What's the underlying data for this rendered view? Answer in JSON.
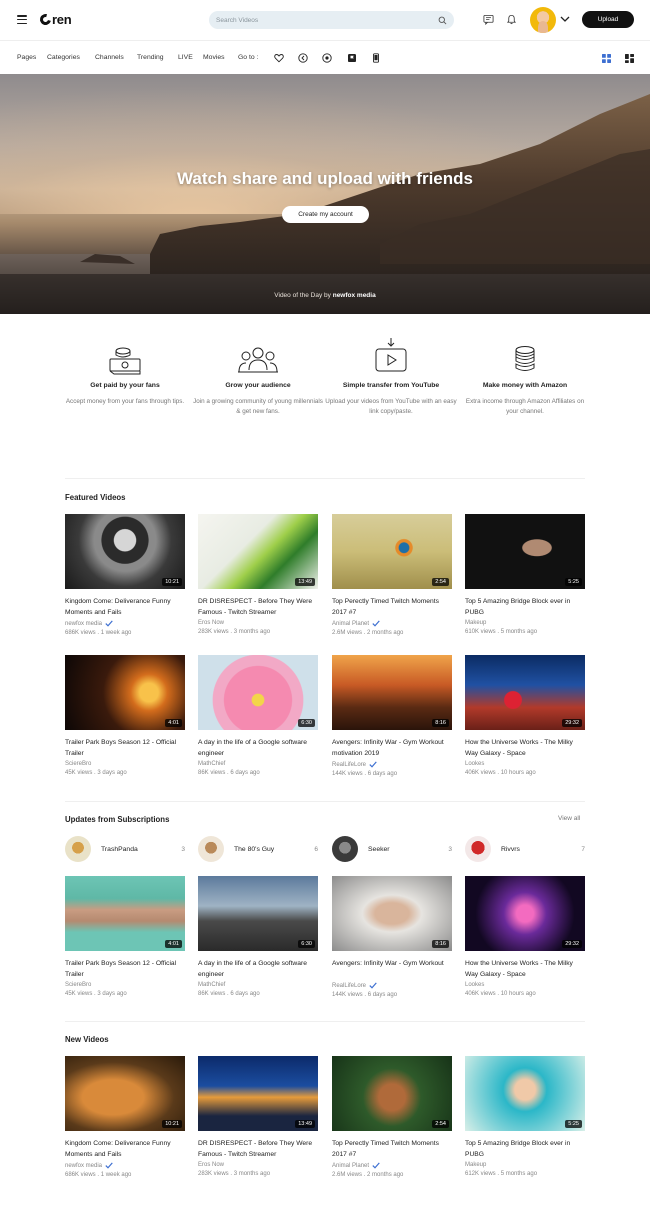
{
  "header": {
    "logo": "Oren",
    "search_placeholder": "Search Videos",
    "upload_label": "Upload"
  },
  "nav": {
    "items": [
      "Pages",
      "Categories",
      "Channels",
      "Trending",
      "LIVE",
      "Movies"
    ],
    "goto_label": "Go to :"
  },
  "hero": {
    "title": "Watch share and upload with friends",
    "cta": "Create my account",
    "credit_prefix": "Video of the Day by",
    "credit_channel": "newfox media"
  },
  "features": [
    {
      "icon": "money-icon",
      "title": "Get paid by your fans",
      "desc": "Accept money from your fans through tips."
    },
    {
      "icon": "audience-icon",
      "title": "Grow your audience",
      "desc": "Join a growing community of young millennials & get new fans."
    },
    {
      "icon": "video-transfer-icon",
      "title": "Simple transfer from YouTube",
      "desc": "Upload your videos from YouTube with an easy link copy/paste."
    },
    {
      "icon": "coins-icon",
      "title": "Make money with Amazon",
      "desc": "Extra income through Amazon Affiliates on your channel."
    }
  ],
  "featured": {
    "title": "Featured Videos",
    "videos": [
      {
        "title": "Kingdom Come: Deliverance Funny Moments and Fails",
        "channel": "newfox media",
        "verified": true,
        "views": "686K views",
        "ago": "1 week ago",
        "duration": "10:21"
      },
      {
        "title": "DR DISRESPECT - Before They Were Famous - Twitch Streamer",
        "channel": "Eros Now",
        "verified": false,
        "views": "283K views",
        "ago": "3 months ago",
        "duration": "13:49"
      },
      {
        "title": "Top Perectly Timed Twitch Moments 2017 #7",
        "channel": "Animal Planet",
        "verified": true,
        "views": "2.6M views",
        "ago": "2 months ago",
        "duration": "2:54"
      },
      {
        "title": "Top 5 Amazing Bridge Block ever in PUBG",
        "channel": "Makeup",
        "verified": false,
        "views": "610K views",
        "ago": "5 months ago",
        "duration": "5:25"
      },
      {
        "title": "Trailer Park Boys Season 12 - Official Trailer",
        "channel": "SciereBro",
        "verified": false,
        "views": "45K views",
        "ago": "3 days ago",
        "duration": "4:01"
      },
      {
        "title": "A day in the life of a Google software engineer",
        "channel": "MathChief",
        "verified": false,
        "views": "86K views",
        "ago": "6 days ago",
        "duration": "6:30"
      },
      {
        "title": "Avengers: Infinity War - Gym Workout motivation 2019",
        "channel": "RealLifeLore",
        "verified": true,
        "views": "144K views",
        "ago": "6 days ago",
        "duration": "8:16"
      },
      {
        "title": "How the Universe Works - The Milky Way Galaxy - Space",
        "channel": "Lookes",
        "verified": false,
        "views": "406K views",
        "ago": "10 hours ago",
        "duration": "29:32"
      }
    ]
  },
  "subscriptions": {
    "title": "Updates from Subscriptions",
    "view_all": "View all",
    "channels": [
      {
        "name": "TrashPanda",
        "count": "3"
      },
      {
        "name": "The 80's Guy",
        "count": "6"
      },
      {
        "name": "Seeker",
        "count": "3"
      },
      {
        "name": "Rivvrs",
        "count": "7"
      }
    ],
    "videos": [
      {
        "title": "Trailer Park Boys Season 12 - Official Trailer",
        "channel": "SciereBro",
        "verified": false,
        "views": "45K views",
        "ago": "3 days ago",
        "duration": "4:01"
      },
      {
        "title": "A day in the life of a Google software engineer",
        "channel": "MathChief",
        "verified": false,
        "views": "86K views",
        "ago": "6 days ago",
        "duration": "6:30"
      },
      {
        "title": "Avengers: Infinity War - Gym Workout",
        "channel": "RealLifeLore",
        "verified": true,
        "views": "144K views",
        "ago": "6 days ago",
        "duration": "8:16"
      },
      {
        "title": "How the Universe Works - The Milky Way Galaxy - Space",
        "channel": "Lookes",
        "verified": false,
        "views": "406K views",
        "ago": "10 hours ago",
        "duration": "29:32"
      }
    ]
  },
  "new_videos": {
    "title": "New Videos",
    "videos": [
      {
        "title": "Kingdom Come: Deliverance Funny Moments and Fails",
        "channel": "newfox media",
        "verified": true,
        "views": "686K views",
        "ago": "1 week ago",
        "duration": "10:21"
      },
      {
        "title": "DR DISRESPECT - Before They Were Famous - Twitch Streamer",
        "channel": "Eros Now",
        "verified": false,
        "views": "283K views",
        "ago": "3 months ago",
        "duration": "13:49"
      },
      {
        "title": "Top Perectly Timed Twitch Moments 2017 #7",
        "channel": "Animal Planet",
        "verified": true,
        "views": "2.6M views",
        "ago": "2 months ago",
        "duration": "2:54"
      },
      {
        "title": "Top 5 Amazing Bridge Block ever in PUBG",
        "channel": "Makeup",
        "verified": false,
        "views": "612K views",
        "ago": "5 months ago",
        "duration": "5:25"
      }
    ]
  },
  "colors": {
    "verified": "#3d6fd1",
    "view_toggle_active": "#3d6fd1",
    "upload_bg": "#111111",
    "search_bg": "#e6eef3"
  }
}
